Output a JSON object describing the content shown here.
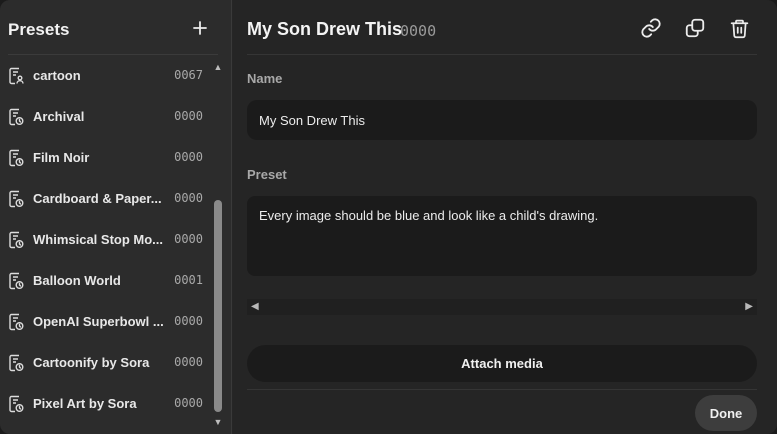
{
  "sidebar": {
    "title": "Presets",
    "add_icon": "plus-icon",
    "items": [
      {
        "label": "cartoon",
        "code": "0067",
        "icon": "preset-person-icon"
      },
      {
        "label": "Archival",
        "code": "0000",
        "icon": "preset-clock-icon"
      },
      {
        "label": "Film Noir",
        "code": "0000",
        "icon": "preset-clock-icon"
      },
      {
        "label": "Cardboard & Paper...",
        "code": "0000",
        "icon": "preset-clock-icon"
      },
      {
        "label": "Whimsical Stop Mo...",
        "code": "0000",
        "icon": "preset-clock-icon"
      },
      {
        "label": "Balloon World",
        "code": "0001",
        "icon": "preset-clock-icon"
      },
      {
        "label": "OpenAI Superbowl ...",
        "code": "0000",
        "icon": "preset-clock-icon"
      },
      {
        "label": "Cartoonify by Sora",
        "code": "0000",
        "icon": "preset-clock-icon"
      },
      {
        "label": "Pixel Art by Sora",
        "code": "0000",
        "icon": "preset-clock-icon"
      }
    ]
  },
  "main": {
    "title": "My Son Drew This",
    "title_code": "0000",
    "actions": [
      "link-icon",
      "duplicate-icon",
      "trash-icon"
    ],
    "name_label": "Name",
    "name_value": "My Son Drew This",
    "preset_label": "Preset",
    "preset_value": "Every image should be blue and look like a child's drawing.",
    "attach_label": "Attach media",
    "done_label": "Done"
  }
}
